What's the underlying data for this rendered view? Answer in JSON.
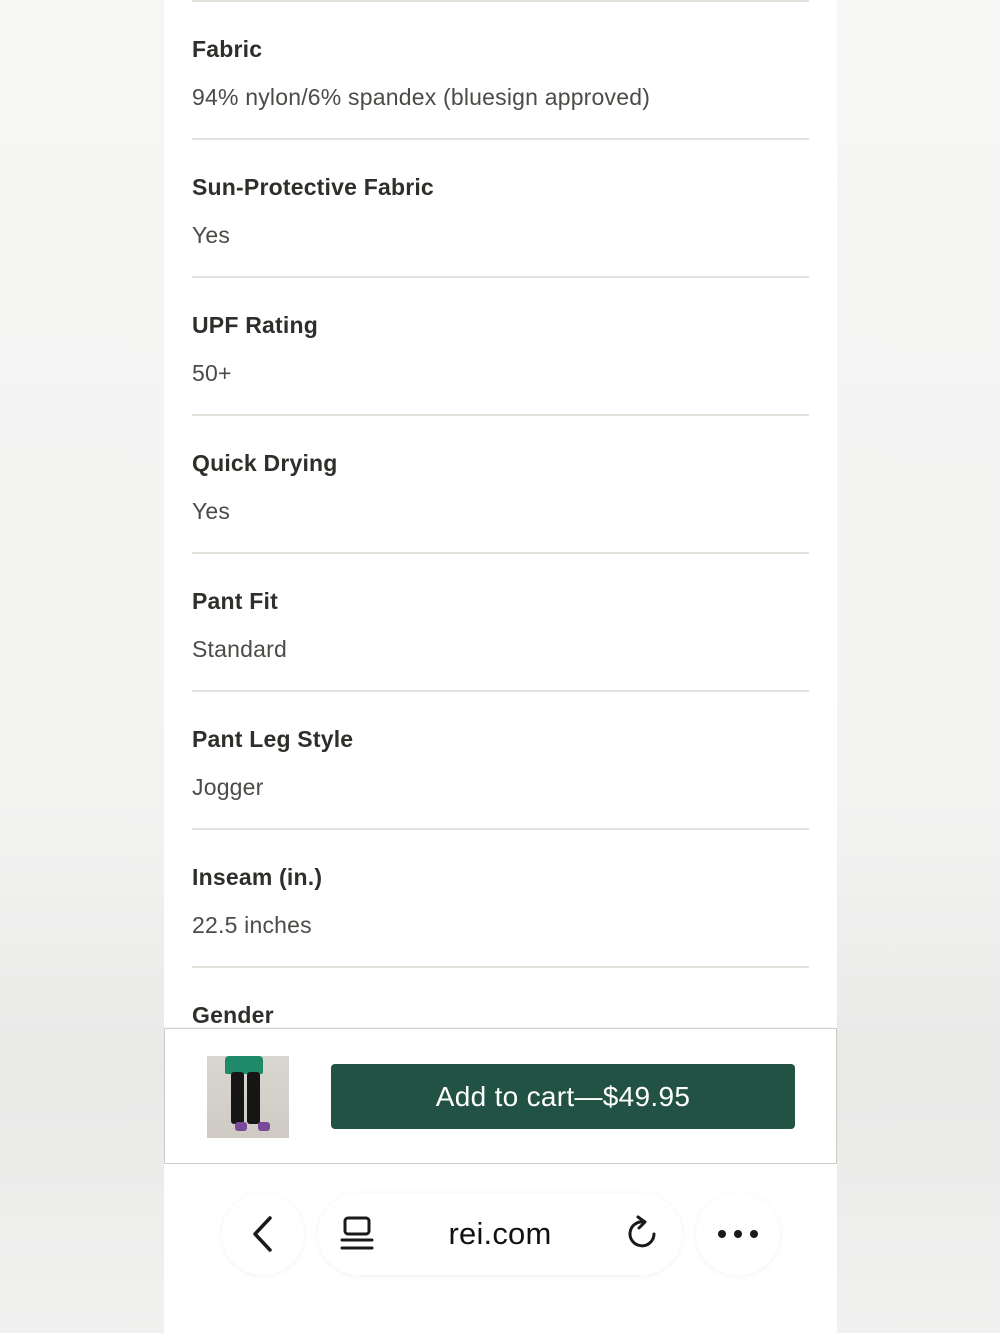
{
  "specs": [
    {
      "label": "Fabric",
      "value": "94% nylon/6% spandex (bluesign approved)"
    },
    {
      "label": "Sun-Protective Fabric",
      "value": "Yes"
    },
    {
      "label": "UPF Rating",
      "value": "50+"
    },
    {
      "label": "Quick Drying",
      "value": "Yes"
    },
    {
      "label": "Pant Fit",
      "value": "Standard"
    },
    {
      "label": "Pant Leg Style",
      "value": "Jogger"
    },
    {
      "label": "Inseam (in.)",
      "value": "22.5 inches"
    },
    {
      "label": "Gender",
      "value": ""
    }
  ],
  "cart": {
    "button_label": "Add to cart—$49.95",
    "button_color": "#215244",
    "thumbnail_icon": "product-thumbnail-kids-jogger-pants"
  },
  "browser": {
    "url": "rei.com",
    "back_icon": "chevron-left-icon",
    "tabs_icon": "tabs-icon",
    "reload_icon": "reload-icon",
    "more_icon": "more-dots-icon"
  }
}
